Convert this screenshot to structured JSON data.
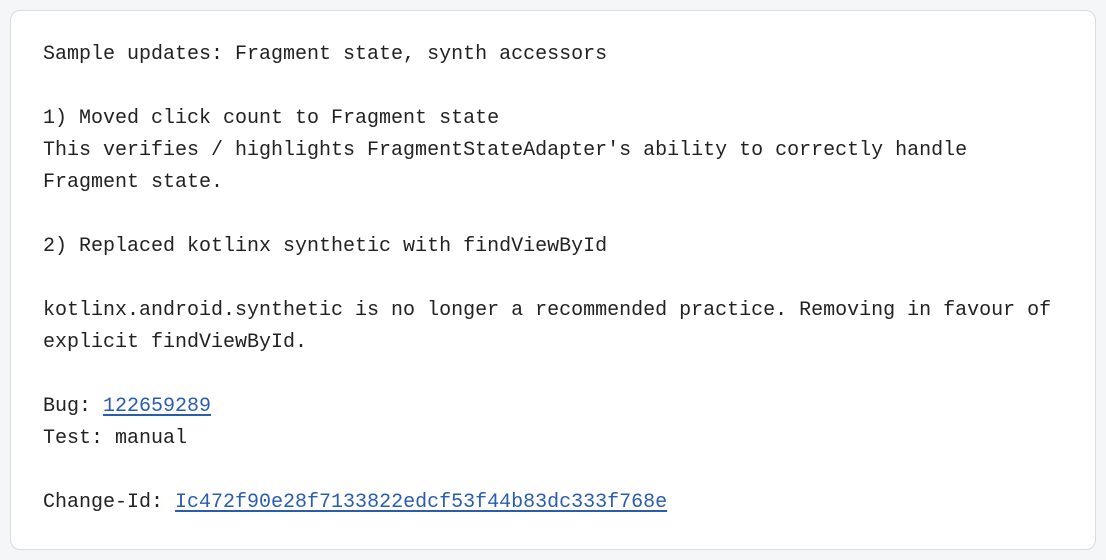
{
  "commit": {
    "title": "Sample updates: Fragment state, synth accessors",
    "body_lines": [
      "1) Moved click count to Fragment state",
      "This verifies / highlights FragmentStateAdapter's ability to correctly handle Fragment state.",
      "",
      "2) Replaced kotlinx synthetic with findViewById",
      "",
      "kotlinx.android.synthetic is no longer a recommended practice. Removing in favour of explicit findViewById."
    ],
    "bug_label": "Bug: ",
    "bug_id": "122659289",
    "test_label": "Test: ",
    "test_value": "manual",
    "changeid_label": "Change-Id: ",
    "changeid_value": "Ic472f90e28f7133822edcf53f44b83dc333f768e"
  }
}
